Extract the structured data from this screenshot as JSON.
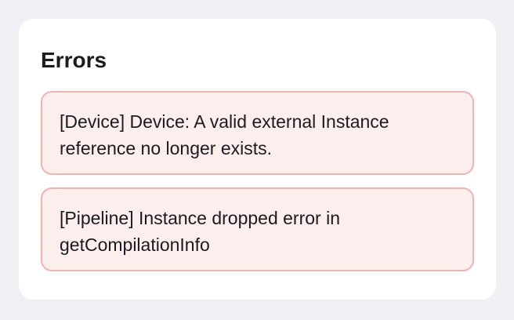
{
  "panel": {
    "title": "Errors",
    "errors": [
      {
        "message": "[Device] Device: A valid external Instance reference no longer exists."
      },
      {
        "message": "[Pipeline] Instance dropped error in getCompilationInfo"
      }
    ]
  },
  "colors": {
    "page_background": "#efeff4",
    "panel_background": "#ffffff",
    "error_background": "#fdeeee",
    "error_border": "#edb4b0",
    "text": "#1b1b1f"
  }
}
